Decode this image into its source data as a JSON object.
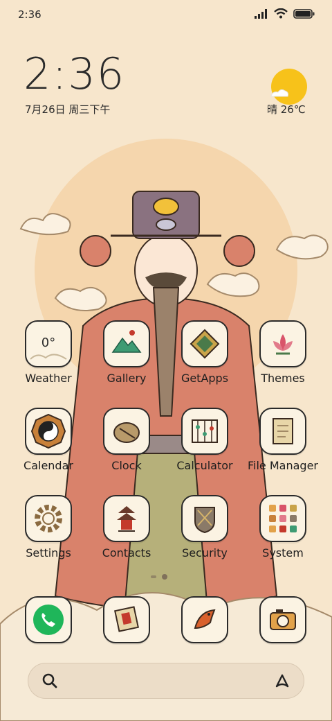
{
  "status_bar": {
    "time": "2:36"
  },
  "clock": {
    "time": "2:36",
    "date": "7月26日 周三下午"
  },
  "weather": {
    "condition": "晴",
    "temperature": "26℃",
    "text": "晴 26℃"
  },
  "apps": [
    {
      "label": "Weather",
      "icon": "weather-icon",
      "tile_text": "0°"
    },
    {
      "label": "Gallery",
      "icon": "gallery-icon"
    },
    {
      "label": "GetApps",
      "icon": "getapps-icon"
    },
    {
      "label": "Themes",
      "icon": "themes-icon"
    },
    {
      "label": "Calendar",
      "icon": "calendar-icon"
    },
    {
      "label": "Clock",
      "icon": "clock-icon"
    },
    {
      "label": "Calculator",
      "icon": "calculator-icon"
    },
    {
      "label": "File Manager",
      "icon": "file-manager-icon"
    },
    {
      "label": "Settings",
      "icon": "settings-icon"
    },
    {
      "label": "Contacts",
      "icon": "contacts-icon"
    },
    {
      "label": "Security",
      "icon": "security-icon"
    },
    {
      "label": "System",
      "icon": "system-folder-icon"
    }
  ],
  "dock": [
    {
      "icon": "phone-icon"
    },
    {
      "icon": "messages-icon"
    },
    {
      "icon": "browser-icon"
    },
    {
      "icon": "camera-icon"
    }
  ],
  "colors": {
    "background": "#f7e6cc",
    "sun": "#f5d6ad",
    "robe": "#d9826b",
    "accent_gold": "#f2c13a"
  }
}
